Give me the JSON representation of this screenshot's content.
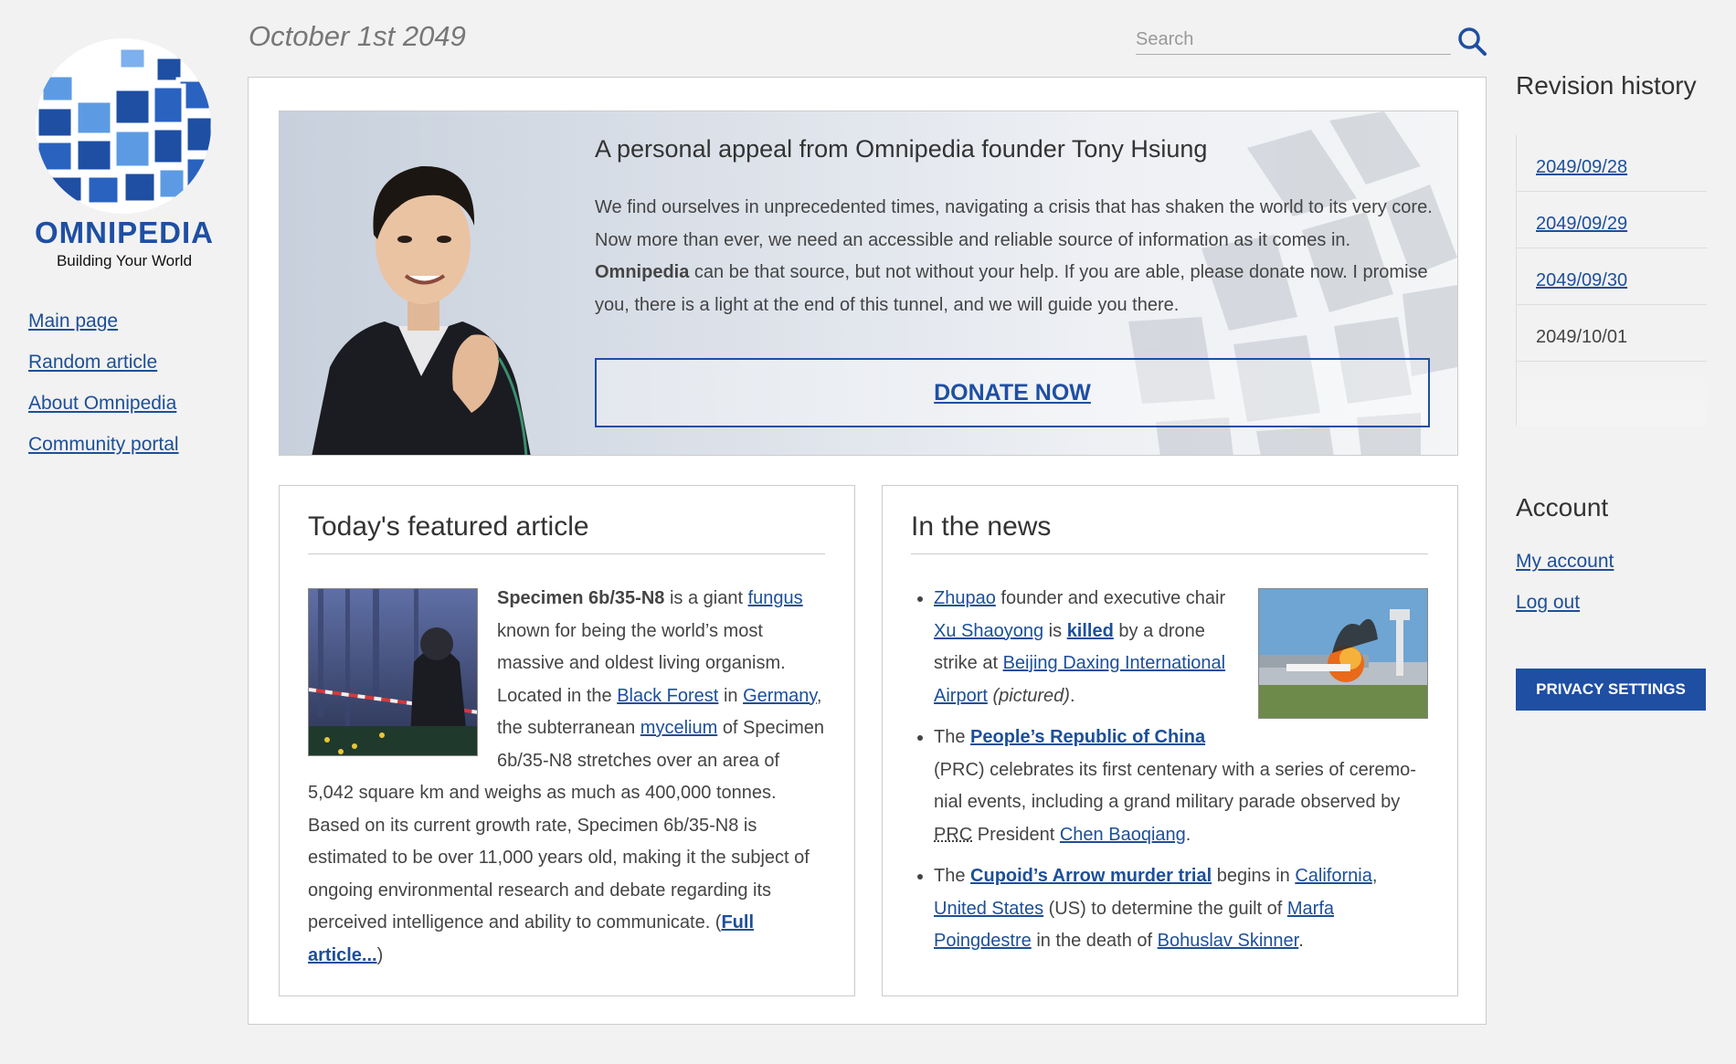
{
  "brand": {
    "name": "OMNIPEDIA",
    "tagline": "Building Your World",
    "colors": {
      "primary": "#1e4fa3",
      "link": "#1d4f98",
      "background": "#f2f2f2"
    }
  },
  "nav": {
    "items": [
      {
        "label": "Main page"
      },
      {
        "label": "Random article"
      },
      {
        "label": "About Omnipedia"
      },
      {
        "label": "Community portal"
      }
    ]
  },
  "header": {
    "date": "October 1st 2049",
    "search": {
      "placeholder": "Search",
      "icon": "search-icon"
    }
  },
  "appeal": {
    "title": "A personal appeal from Omnipedia founder Tony Hsiung",
    "text_before_bold": "We find ourselves in unprecedented times, navigating a crisis that has shaken the world to its very core. Now more than ever, we need an accessible and reliable source of information as it comes in.",
    "bold_word": "Omnipedia",
    "text_after_bold": "can be that source, but not without your help. If you are able, please donate now. I promise you, there is a light at the end of this tunnel, and we will guide you there.",
    "donate_label": "DONATE NOW"
  },
  "featured": {
    "heading": "Today's featured article",
    "subject": "Specimen 6b/35-N8",
    "t1": "is a giant",
    "link_fungus": "fungus",
    "t2": "known for being the world’s most massive and oldest living organism. Located in the",
    "link_black_forest": "Black Forest",
    "t3": "in",
    "link_germany": "Germany",
    "t4": ", the subterranean",
    "link_mycelium": "mycelium",
    "t5": "of Specimen 6b/35-N8 stretches over an area of 5,042 square km and weighs as much as 400,000 tonnes. Based on its current growth rate, Specimen 6b/35-N8 is estimated to be over 11,000 years old, making it the subject of ongoing environ­mental research and debate regarding its perceived intelli­gence and ability to communicate. (",
    "full_article": "Full article...",
    "t6": ")"
  },
  "news": {
    "heading": "In the news",
    "item1": {
      "link_zhupao": "Zhupao",
      "t1": "founder and executive chair",
      "link_person": "Xu Shaoyong",
      "t2": "is",
      "link_killed": "killed",
      "t3": "by a drone strike at",
      "link_airport": "Beijing Daxing International Airport",
      "pictured": "(pictured)",
      "t4": "."
    },
    "item2": {
      "t1": "The",
      "link_prc": "People’s Republic of China",
      "t2": "(PRC) celebrates its first centenary with a series of ceremo­nial events, including a grand military parade observed by",
      "abbr_prc": "PRC",
      "t3": "President",
      "link_president": "Chen Baoqiang",
      "t4": "."
    },
    "item3": {
      "t1": "The",
      "link_trial": "Cupoid’s Arrow murder trial",
      "t2": "begins in",
      "link_california": "California",
      "t3": ",",
      "link_us": "United States",
      "t4": "(US) to determine the guilt of",
      "link_marfa": "Marfa Poingdestre",
      "t5": "in the death of",
      "link_bohuslav": "Bohuslav Skinner",
      "t6": "."
    }
  },
  "revisions": {
    "title": "Revision history",
    "items": [
      {
        "label": "2049/09/28"
      },
      {
        "label": "2049/09/29"
      },
      {
        "label": "2049/09/30"
      },
      {
        "label": "2049/10/01"
      }
    ]
  },
  "account": {
    "title": "Account",
    "my_account": "My account",
    "log_out": "Log out",
    "privacy": "PRIVACY SETTINGS"
  }
}
